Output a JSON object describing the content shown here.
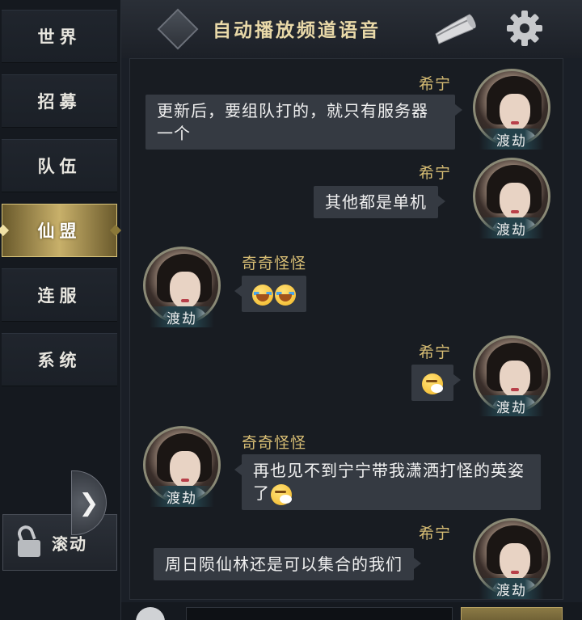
{
  "sidebar": {
    "tabs": [
      {
        "label": "世界"
      },
      {
        "label": "招募"
      },
      {
        "label": "队伍"
      },
      {
        "label": "仙盟",
        "active": true
      },
      {
        "label": "连服"
      },
      {
        "label": "系统"
      }
    ],
    "scroll_label": "滚动"
  },
  "header": {
    "title": "自动播放频道语音"
  },
  "messages": [
    {
      "side": "right",
      "sender": "希宁",
      "avatar_tag": "渡劫",
      "text": "更新后，要组队打的，就只有服务器一个"
    },
    {
      "side": "right",
      "sender": "希宁",
      "avatar_tag": "渡劫",
      "text": "其他都是单机"
    },
    {
      "side": "left",
      "sender": "奇奇怪怪",
      "avatar_tag": "渡劫",
      "emojis": [
        "crying-emoji",
        "crying-emoji"
      ]
    },
    {
      "side": "right",
      "sender": "希宁",
      "avatar_tag": "渡劫",
      "emojis": [
        "sneezing-emoji"
      ]
    },
    {
      "side": "left",
      "sender": "奇奇怪怪",
      "avatar_tag": "渡劫",
      "text": "再也见不到宁宁带我潇洒打怪的英姿了",
      "emojis": [
        "sneezing-emoji"
      ]
    },
    {
      "side": "right",
      "sender": "希宁",
      "avatar_tag": "渡劫",
      "text": "周日陨仙林还是可以集合的我们"
    }
  ],
  "colors": {
    "accent_gold": "#d7bd74",
    "bubble_bg": "#353a42",
    "active_tab": "#c8b06a"
  }
}
